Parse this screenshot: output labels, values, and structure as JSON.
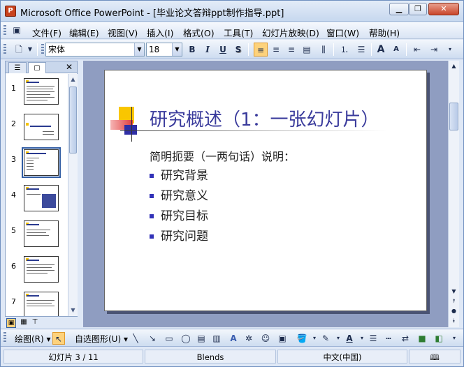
{
  "window": {
    "title": "Microsoft Office PowerPoint - [毕业论文答辩ppt制作指导.ppt]",
    "app_icon": "powerpoint-icon",
    "controls": [
      "minimize-icon",
      "restore-icon",
      "close-icon"
    ]
  },
  "menubar": {
    "items": [
      "文件(F)",
      "编辑(E)",
      "视图(V)",
      "插入(I)",
      "格式(O)",
      "工具(T)",
      "幻灯片放映(D)",
      "窗口(W)",
      "帮助(H)"
    ]
  },
  "toolbar": {
    "font_name": "宋体",
    "font_size": "18",
    "bold": "B",
    "italic": "I",
    "underline": "U",
    "shadow": "S",
    "grow_font": "A",
    "shrink_font": "A"
  },
  "left_pane": {
    "slide_numbers": [
      "1",
      "2",
      "3",
      "4",
      "5",
      "6",
      "7"
    ],
    "selected_slide": 3,
    "close": "✕"
  },
  "slide": {
    "title": "研究概述（1：一张幻灯片）",
    "subtitle": "简明扼要（一两句话）说明：",
    "bullets": [
      "研究背景",
      "研究意义",
      "研究目标",
      "研究问题"
    ]
  },
  "drawbar": {
    "draw_label": "绘图(R)",
    "autoshapes_label": "自选图形(U)",
    "font_color_letter": "A"
  },
  "statusbar": {
    "slide_info": "幻灯片 3 / 11",
    "design": "Blends",
    "language": "中文(中国)"
  },
  "colors": {
    "title_color": "#3a3b9c",
    "bullet_color": "#3232b8",
    "accent_yellow": "#f9c600",
    "accent_red": "#e23c3c"
  }
}
